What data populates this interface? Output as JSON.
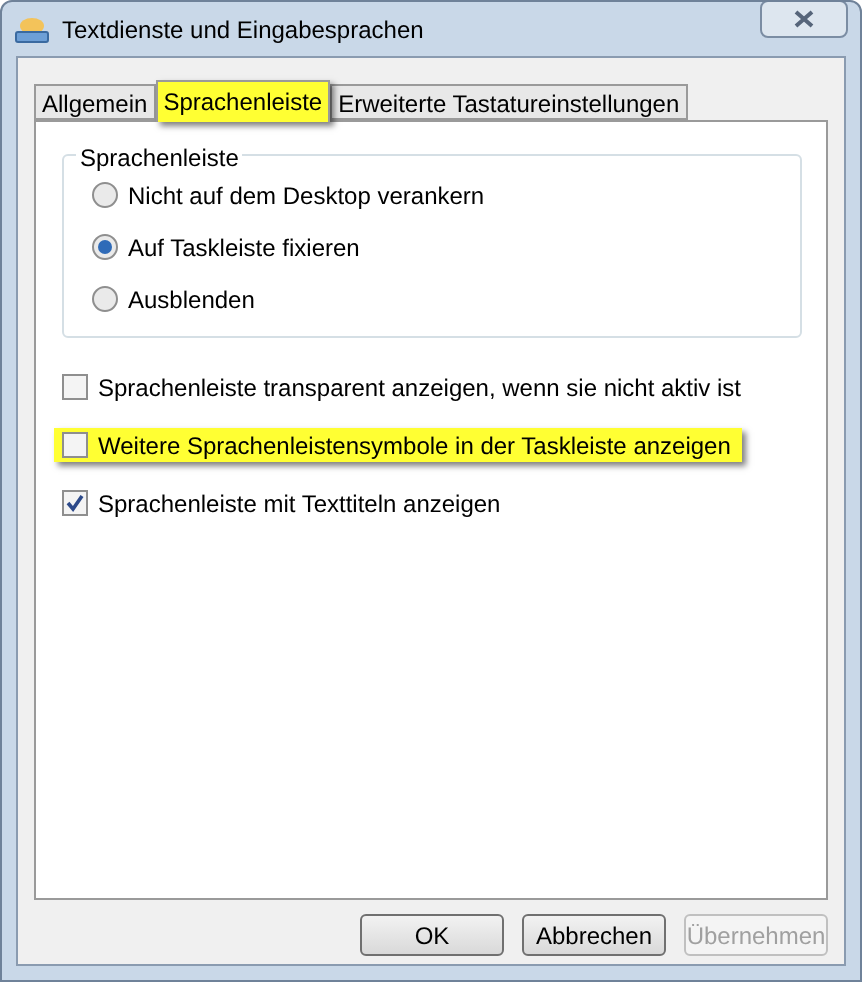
{
  "window": {
    "title": "Textdienste und Eingabesprachen"
  },
  "tabs": [
    {
      "label": "Allgemein",
      "selected": false,
      "highlighted": false
    },
    {
      "label": "Sprachenleiste",
      "selected": true,
      "highlighted": true
    },
    {
      "label": "Erweiterte Tastatureinstellungen",
      "selected": false,
      "highlighted": false
    }
  ],
  "group": {
    "title": "Sprachenleiste",
    "options": [
      {
        "label": "Nicht auf dem Desktop verankern",
        "selected": false
      },
      {
        "label": "Auf Taskleiste fixieren",
        "selected": true
      },
      {
        "label": "Ausblenden",
        "selected": false
      }
    ]
  },
  "checkboxes": [
    {
      "label": "Sprachenleiste transparent anzeigen, wenn sie nicht aktiv ist",
      "checked": false,
      "highlighted": false
    },
    {
      "label": "Weitere Sprachenleistensymbole in der Taskleiste anzeigen",
      "checked": false,
      "highlighted": true
    },
    {
      "label": "Sprachenleiste mit Texttiteln anzeigen",
      "checked": true,
      "highlighted": false
    }
  ],
  "buttons": [
    {
      "label": "OK",
      "disabled": false
    },
    {
      "label": "Abbrechen",
      "disabled": false
    },
    {
      "label": "Übernehmen",
      "disabled": true
    }
  ]
}
